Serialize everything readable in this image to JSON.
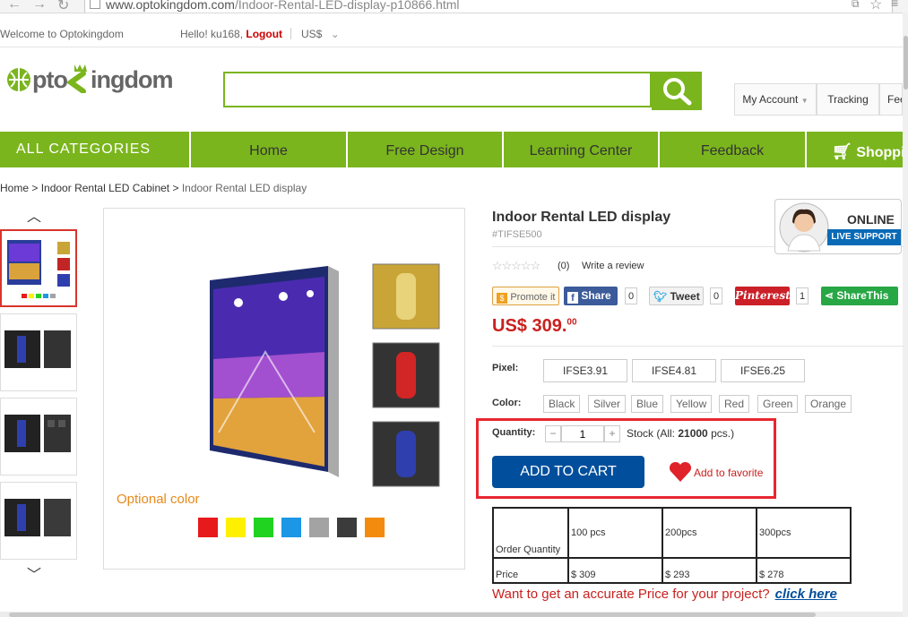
{
  "browser": {
    "url_prefix": "www.optokingdom.com",
    "url_path": "/Indoor-Rental-LED-display-p10866.html"
  },
  "topbar": {
    "welcome": "Welcome to Optokingdom",
    "hello": "Hello! ku168,",
    "logout": "Logout",
    "currency": "US$"
  },
  "logo": {
    "part1": "pto",
    "part2": "ingdom"
  },
  "search": {
    "placeholder": ""
  },
  "account": {
    "my_account": "My Account",
    "tracking": "Tracking",
    "feedback_cut": "Fee"
  },
  "nav": {
    "all_categories": "ALL CATEGORIES",
    "items": [
      "Home",
      "Free Design",
      "Learning Center",
      "Feedback"
    ],
    "shopping": "Shoppi"
  },
  "breadcrumb": {
    "home": "Home",
    "category": "Indoor Rental LED Cabinet",
    "current": "Indoor Rental LED display"
  },
  "gallery": {
    "optional_color": "Optional color"
  },
  "colors": {
    "brand_green": "#7ab51d",
    "swatches": [
      "#e8191b",
      "#ffef00",
      "#21d321",
      "#1b97e6",
      "#a3a3a3",
      "#3b3b3b",
      "#f38b0e"
    ]
  },
  "product": {
    "title": "Indoor Rental LED display",
    "sku": "#TIFSE500",
    "rating_count": "(0)",
    "write_review": "Write a review",
    "price_main": "US$ 309.",
    "price_cents": "00"
  },
  "social": {
    "promote": "Promote it",
    "share": "Share",
    "share_count": "0",
    "tweet": "Tweet",
    "tweet_count": "0",
    "pinterest": "Pinterest",
    "pinterest_count": "1",
    "sharethis": "ShareThis"
  },
  "options": {
    "pixel_label": "Pixel:",
    "pixel": [
      "IFSE3.91",
      "IFSE4.81",
      "IFSE6.25"
    ],
    "color_label": "Color:",
    "color": [
      "Black",
      "Silver",
      "Blue",
      "Yellow",
      "Red",
      "Green",
      "Orange"
    ]
  },
  "purchase": {
    "quantity_label": "Quantity:",
    "minus": "−",
    "quantity": "1",
    "plus": "+",
    "stock_prefix": "Stock (All:",
    "stock_value": "21000",
    "stock_suffix": "pcs.)",
    "add_to_cart": "ADD TO CART",
    "add_to_favorite": "Add to favorite"
  },
  "price_table": {
    "header": [
      "Order Quantity",
      "100 pcs",
      "200pcs",
      "300pcs"
    ],
    "row": [
      "Price",
      "$ 309",
      "$ 293",
      "$ 278"
    ]
  },
  "cta": {
    "text": "Want to get an accurate Price for your project?",
    "link": "click here"
  },
  "live_support": {
    "line1": "ONLINE",
    "line2": "LIVE SUPPORT"
  }
}
